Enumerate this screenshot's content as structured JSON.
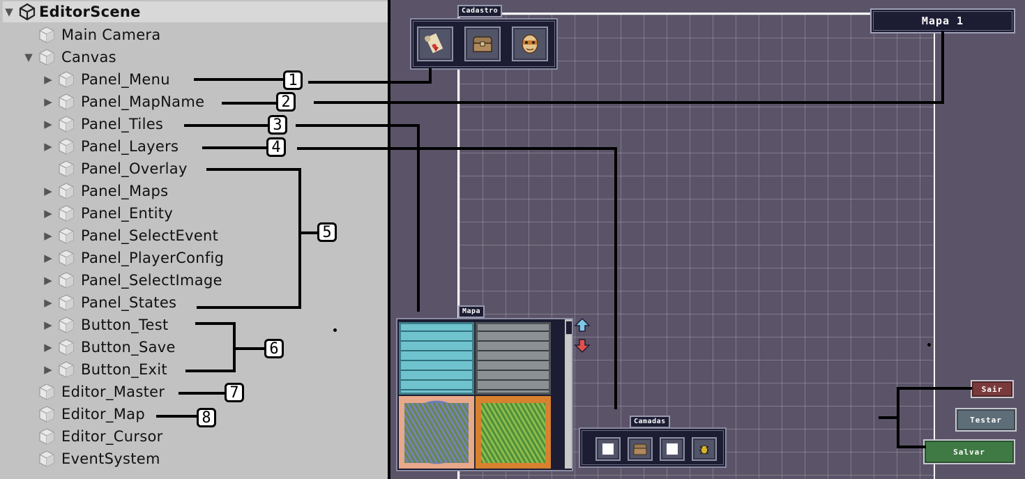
{
  "hierarchy": {
    "scene_name": "EditorScene",
    "items": [
      {
        "label": "Main Camera"
      },
      {
        "label": "Canvas"
      },
      {
        "label": "Panel_Menu"
      },
      {
        "label": "Panel_MapName"
      },
      {
        "label": "Panel_Tiles"
      },
      {
        "label": "Panel_Layers"
      },
      {
        "label": "Panel_Overlay"
      },
      {
        "label": "Panel_Maps"
      },
      {
        "label": "Panel_Entity"
      },
      {
        "label": "Panel_SelectEvent"
      },
      {
        "label": "Panel_PlayerConfig"
      },
      {
        "label": "Panel_SelectImage"
      },
      {
        "label": "Panel_States"
      },
      {
        "label": "Button_Test"
      },
      {
        "label": "Button_Save"
      },
      {
        "label": "Button_Exit"
      },
      {
        "label": "Editor_Master"
      },
      {
        "label": "Editor_Map"
      },
      {
        "label": "Editor_Cursor"
      },
      {
        "label": "EventSystem"
      }
    ]
  },
  "annotations": [
    "1",
    "2",
    "3",
    "4",
    "5",
    "6",
    "7",
    "8"
  ],
  "game": {
    "menu_panel": {
      "title": "Cadastro",
      "icons": [
        "scroll-icon",
        "chest-icon",
        "mask-icon"
      ]
    },
    "map_name": "Mapa 1",
    "tiles_panel": {
      "title": "Mapa",
      "tiles": [
        "cyan-brick-tile",
        "gray-brick-tile",
        "purple-grass-tile",
        "green-grass-tile"
      ]
    },
    "layers_panel": {
      "title": "Camadas",
      "icons": [
        "empty-layer-icon",
        "chest-layer-icon",
        "empty-layer-icon",
        "bug-layer-icon"
      ]
    },
    "buttons": {
      "exit": "Sair",
      "test": "Testar",
      "save": "Salvar"
    }
  },
  "colors": {
    "hierarchy_bg": "#c2c2c2",
    "game_bg": "#5b5468",
    "panel_bg": "#1c1d33",
    "exit_button": "#7a3a3c",
    "test_button": "#5e6e78",
    "save_button": "#3f7a44"
  }
}
